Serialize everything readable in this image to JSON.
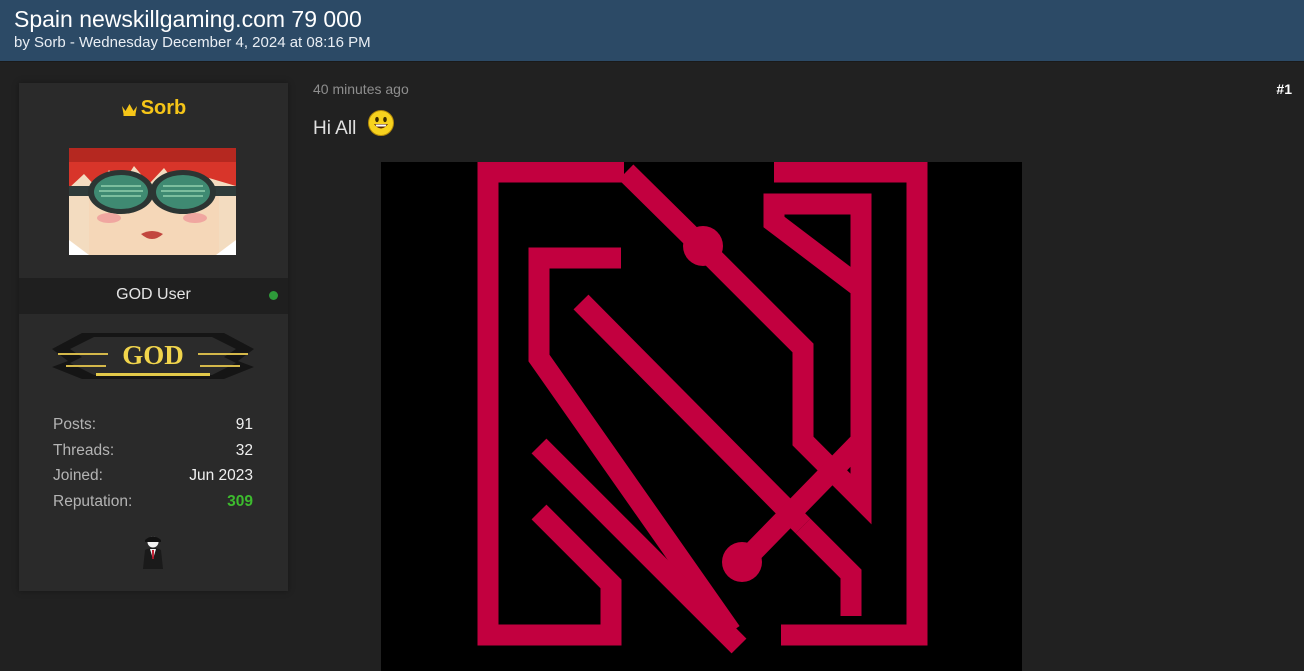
{
  "thread": {
    "title": "Spain newskillgaming.com 79 000",
    "meta": "by Sorb - Wednesday December 4, 2024 at 08:16 PM"
  },
  "user": {
    "name": "Sorb",
    "title": "GOD User",
    "status": "online",
    "rank_badge_text": "GOD",
    "stats": [
      {
        "label": "Posts:",
        "value": "91"
      },
      {
        "label": "Threads:",
        "value": "32"
      },
      {
        "label": "Joined:",
        "value": "Jun 2023"
      },
      {
        "label": "Reputation:",
        "value": "309"
      }
    ]
  },
  "post": {
    "time": "40 minutes ago",
    "number": "#1",
    "text": "Hi All"
  },
  "colors": {
    "header_bg": "#2c4a66",
    "page_bg": "#212121",
    "panel_bg": "#2a2a2a",
    "username": "#f5c518",
    "reputation": "#3dbb2e",
    "logo_red": "#c2003f"
  },
  "icons": {
    "crown": "crown-icon",
    "smiley": "smiley-icon",
    "online": "online-dot-icon",
    "award": "anonymous-award-icon"
  }
}
